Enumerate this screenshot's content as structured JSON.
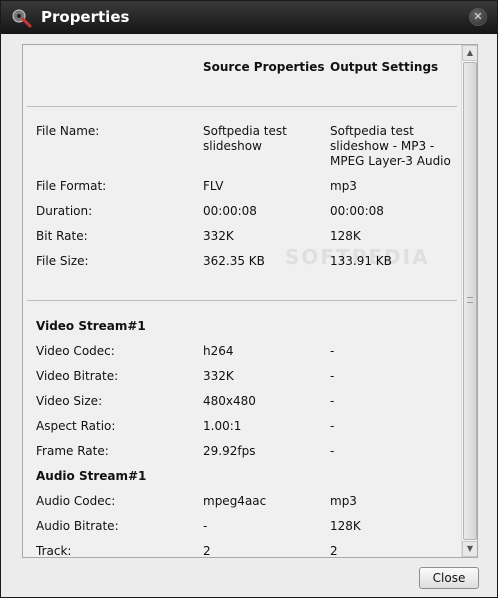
{
  "window": {
    "title": "Properties"
  },
  "headers": {
    "source": "Source Properties",
    "output": "Output Settings"
  },
  "rows": [
    {
      "label": "File Name:",
      "source": "Softpedia test\nslideshow",
      "output": "Softpedia test\nslideshow - MP3 -\nMPEG Layer-3 Audio"
    },
    {
      "label": "File Format:",
      "source": "FLV",
      "output": "mp3"
    },
    {
      "label": "Duration:",
      "source": "00:00:08",
      "output": "00:00:08"
    },
    {
      "label": "Bit Rate:",
      "source": "332K",
      "output": "128K"
    },
    {
      "label": "File Size:",
      "source": "362.35 KB",
      "output": "133.91 KB"
    }
  ],
  "video": {
    "title": "Video Stream#1",
    "rows": [
      {
        "label": "Video Codec:",
        "source": "h264",
        "output": "-"
      },
      {
        "label": "Video Bitrate:",
        "source": "332K",
        "output": "-"
      },
      {
        "label": "Video Size:",
        "source": "480x480",
        "output": "-"
      },
      {
        "label": "Aspect Ratio:",
        "source": "1.00:1",
        "output": "-"
      },
      {
        "label": "Frame Rate:",
        "source": "29.92fps",
        "output": "-"
      }
    ]
  },
  "audio": {
    "title": "Audio Stream#1",
    "rows": [
      {
        "label": "Audio Codec:",
        "source": "mpeg4aac",
        "output": "mp3"
      },
      {
        "label": "Audio Bitrate:",
        "source": "-",
        "output": "128K"
      },
      {
        "label": "Track:",
        "source": "2",
        "output": "2"
      }
    ]
  },
  "watermark": "SOFTPEDIA",
  "buttons": {
    "close": "Close"
  },
  "icons": {
    "app": "media-player-icon",
    "window_close": "close-icon",
    "scroll_up": "chevron-up-icon",
    "scroll_down": "chevron-down-icon"
  }
}
